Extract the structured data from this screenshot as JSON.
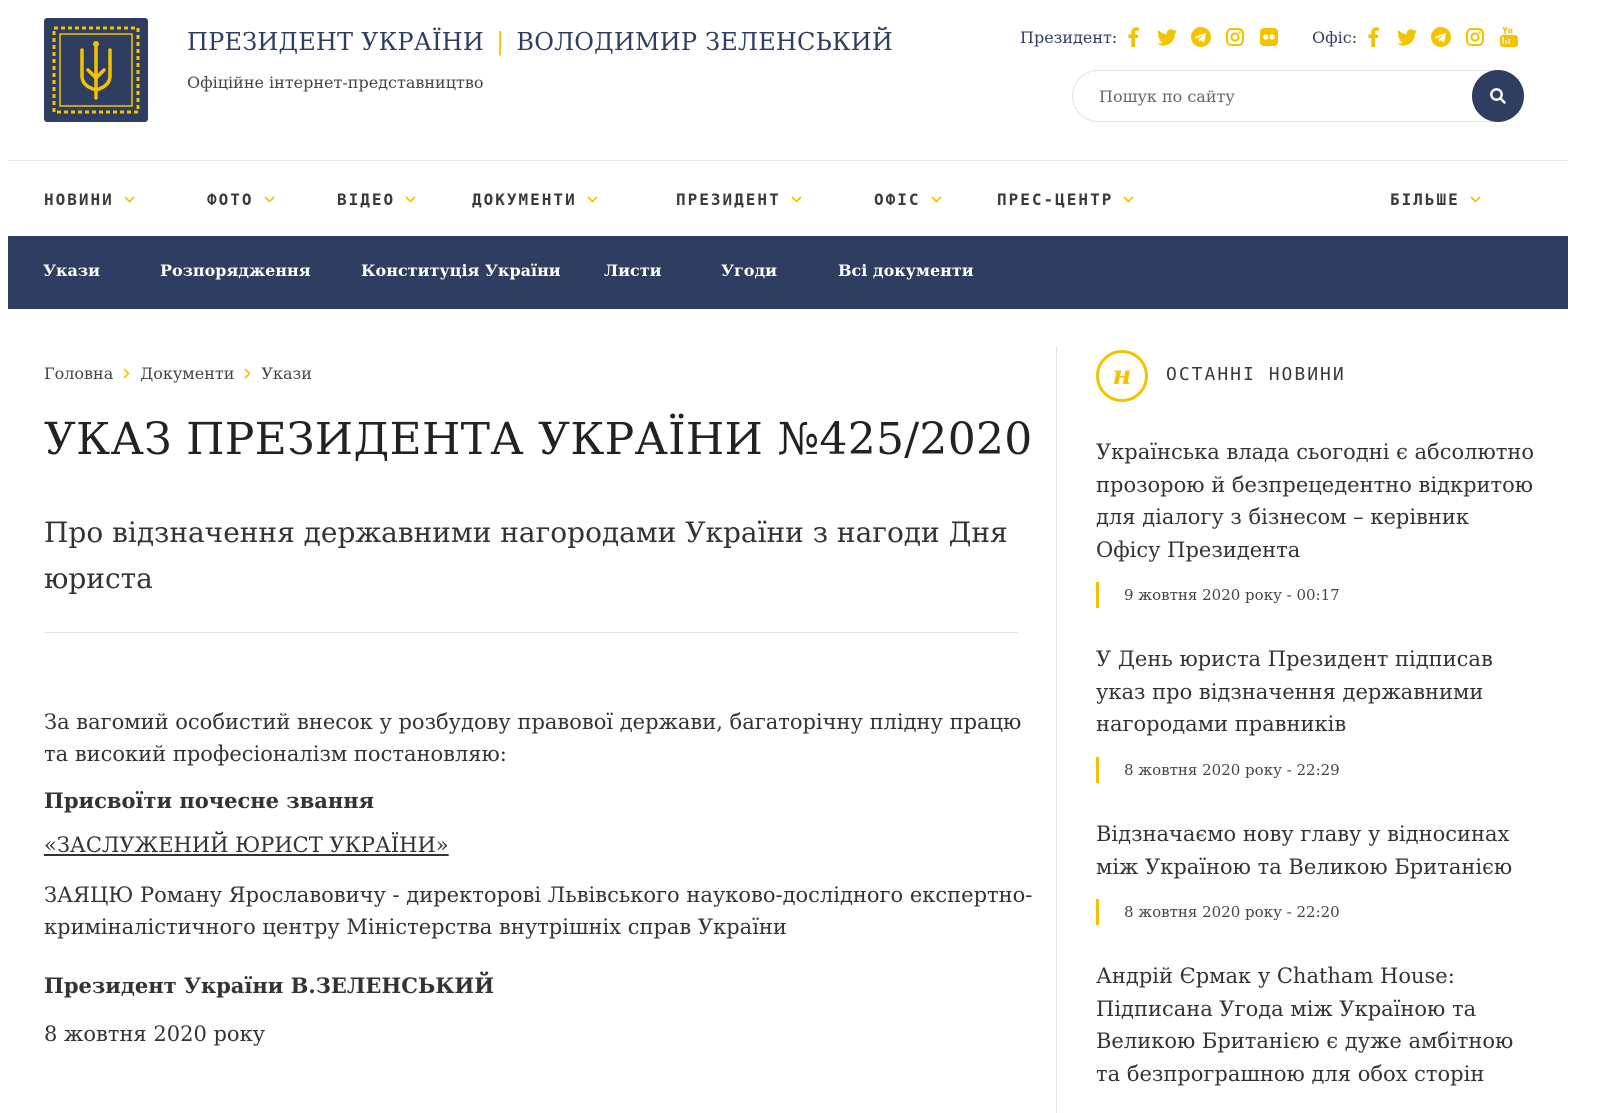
{
  "header": {
    "title_left": "ПРЕЗИДЕНТ УКРАЇНИ",
    "title_separator": "|",
    "title_right": "ВОЛОДИМИР ЗЕЛЕНСЬКИЙ",
    "subtitle": "Офіційне інтернет-представництво",
    "social": {
      "president_label": "Президент:",
      "office_label": "Офіс:",
      "president_icons": [
        "facebook-icon",
        "twitter-icon",
        "telegram-icon",
        "instagram-icon",
        "flickr-icon"
      ],
      "office_icons": [
        "facebook-icon",
        "twitter-icon",
        "telegram-icon",
        "instagram-icon",
        "youtube-icon"
      ]
    },
    "search": {
      "placeholder": "Пошук по сайту",
      "icon": "search-icon"
    }
  },
  "nav": {
    "items": [
      "НОВИНИ",
      "ФОТО",
      "ВІДЕО",
      "ДОКУМЕНТИ",
      "ПРЕЗИДЕНТ",
      "ОФІС",
      "ПРЕС-ЦЕНТР",
      "БІЛЬШЕ"
    ]
  },
  "subnav": {
    "items": [
      "Укази",
      "Розпорядження",
      "Конституція України",
      "Листи",
      "Угоди",
      "Всі документи"
    ]
  },
  "breadcrumb": {
    "items": [
      "Головна",
      "Документи",
      "Укази"
    ]
  },
  "document": {
    "title": "УКАЗ ПРЕЗИДЕНТА УКРАЇНИ №425/2020",
    "subtitle": "Про відзначення державними нагородами України з нагоди Дня юриста",
    "intro": "За вагомий особистий внесок у розбудову правової держави, багаторічну плідну працю та високий професіоналізм  постановляю:",
    "award_heading": "Присвоїти почесне звання",
    "award_title": "«ЗАСЛУЖЕНИЙ ЮРИСТ УКРАЇНИ»",
    "recipient": "ЗАЯЦЮ Роману Ярославовичу - директорові Львівського науково-дослідного експертно-криміналістичного центру Міністерства внутрішніх справ України",
    "signature": "Президент України В.ЗЕЛЕНСЬКИЙ",
    "date": "8 жовтня 2020 року"
  },
  "sidebar": {
    "badge": "н",
    "heading": "ОСТАННІ НОВИНИ",
    "news": [
      {
        "title": "Українська влада сьогодні є абсолютно прозорою й безпрецедентно відкритою для діалогу з бізнесом – керівник Офісу Президента",
        "date": "9 жовтня 2020 року - 00:17"
      },
      {
        "title": "У День юриста Президент підписав указ про відзначення державними нагородами правників",
        "date": "8 жовтня 2020 року - 22:29"
      },
      {
        "title": "Відзначаємо нову главу у відносинах між Україною та Великою Британією",
        "date": "8 жовтня 2020 року - 22:20"
      },
      {
        "title": "Андрій Єрмак у Chatham House: Підписана Угода між Україною та Великою Британією є дуже амбітною та безпрограшною для обох сторін",
        "date": ""
      }
    ]
  },
  "colors": {
    "navy": "#2f3e60",
    "accent": "#f2c400",
    "text": "#333333"
  }
}
